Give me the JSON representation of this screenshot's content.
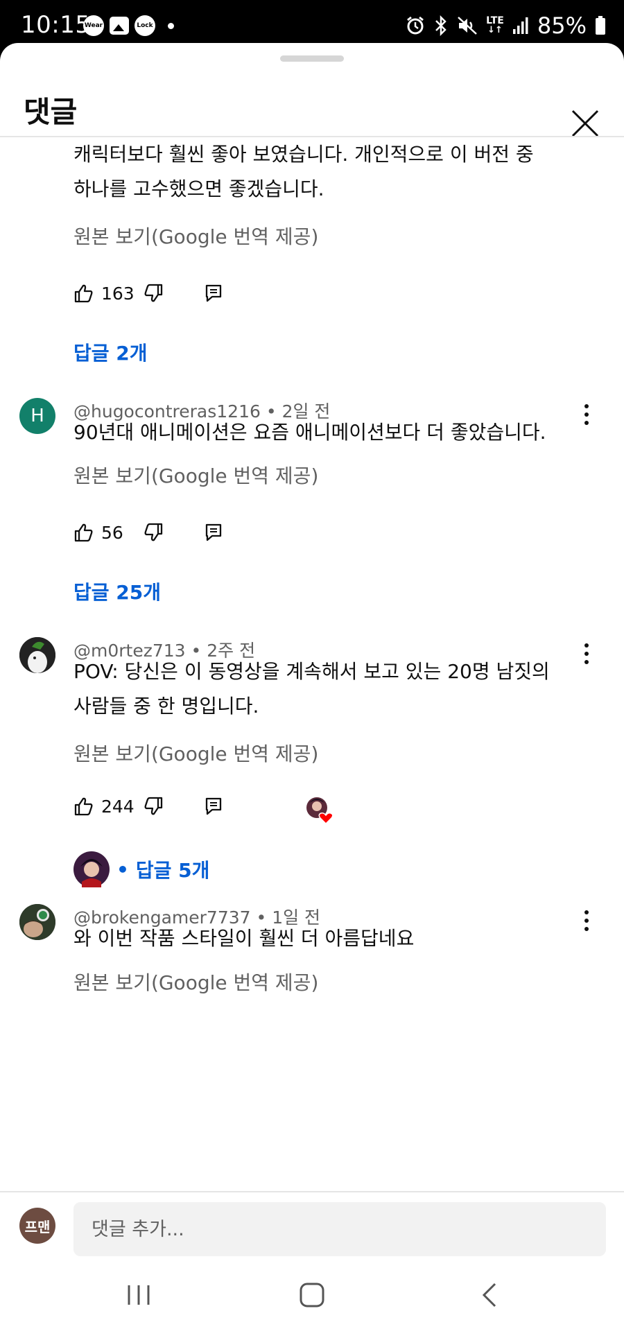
{
  "status_bar": {
    "time": "10:15",
    "left_badges": [
      "Wear",
      "Lock"
    ],
    "battery": "85%",
    "network": "LTE"
  },
  "sheet": {
    "title": "댓글"
  },
  "comments": [
    {
      "text_lines": [
        "캐릭터보다 훨씬 좋아 보였습니다. 개인적으로 이 버전 중",
        "하나를 고수했으면 좋겠습니다."
      ],
      "translate_link": "원본 보기(Google 번역 제공)",
      "likes": "163",
      "replies": "답글 2개"
    },
    {
      "avatar_letter": "H",
      "author": "@hugocontreras1216",
      "time": "2일 전",
      "text_lines": [
        "90년대 애니메이션은 요즘 애니메이션보다 더 좋았습니다."
      ],
      "translate_link": "원본 보기(Google 번역 제공)",
      "likes": "56",
      "replies": "답글 25개"
    },
    {
      "author": "@m0rtez713",
      "time": "2주 전",
      "text_lines": [
        "POV: 당신은 이 동영상을 계속해서 보고 있는 20명 남짓의",
        "사람들 중 한 명입니다."
      ],
      "translate_link": "원본 보기(Google 번역 제공)",
      "likes": "244",
      "replies": "답글 5개"
    },
    {
      "author": "@brokengamer7737",
      "time": "1일 전",
      "text_lines": [
        "와 이번 작품 스타일이 훨씬 더 아름답네요"
      ],
      "translate_link": "원본 보기(Google 번역 제공)"
    }
  ],
  "composer": {
    "avatar_text": "프맨",
    "placeholder": "댓글 추가..."
  },
  "colors": {
    "link_blue": "#065fd4",
    "avatar_green": "#12806a",
    "heart_red": "#ff0000"
  },
  "icons": [
    "like-icon",
    "dislike-icon",
    "reply-icon",
    "more-icon",
    "close-icon",
    "creator-heart-icon"
  ]
}
